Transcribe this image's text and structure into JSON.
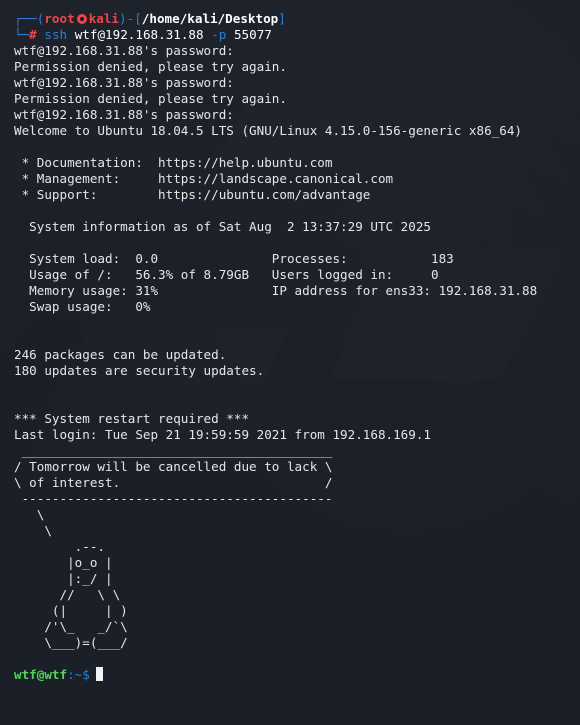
{
  "prompt1": {
    "user": "root",
    "host": "kali",
    "cwd": "/home/kali/Desktop",
    "cmd": "ssh",
    "args": "wtf@192.168.31.88",
    "flag": "-p",
    "port": "55077"
  },
  "lines": {
    "l1": "wtf@192.168.31.88's password:",
    "l2": "Permission denied, please try again.",
    "l3": "wtf@192.168.31.88's password:",
    "l4": "Permission denied, please try again.",
    "l5": "wtf@192.168.31.88's password:",
    "l6": "Welcome to Ubuntu 18.04.5 LTS (GNU/Linux 4.15.0-156-generic x86_64)",
    "l8": " * Documentation:  https://help.ubuntu.com",
    "l9": " * Management:     https://landscape.canonical.com",
    "l10": " * Support:        https://ubuntu.com/advantage",
    "l12": "  System information as of Sat Aug  2 13:37:29 UTC 2025",
    "l14": "  System load:  0.0               Processes:           183",
    "l15": "  Usage of /:   56.3% of 8.79GB   Users logged in:     0",
    "l16": "  Memory usage: 31%               IP address for ens33: 192.168.31.88",
    "l17": "  Swap usage:   0%",
    "l20": "246 packages can be updated.",
    "l21": "180 updates are security updates.",
    "l24": "*** System restart required ***",
    "l25": "Last login: Tue Sep 21 19:59:59 2021 from 192.168.169.1",
    "l26": " _________________________________________",
    "l27": "/ Tomorrow will be cancelled due to lack \\",
    "l28": "\\ of interest.                           /",
    "l29": " -----------------------------------------",
    "l30": "   \\",
    "l31": "    \\",
    "l32": "        .--.",
    "l33": "       |o_o |",
    "l34": "       |:_/ |",
    "l35": "      //   \\ \\",
    "l36": "     (|     | )",
    "l37": "    /'\\_   _/`\\",
    "l38": "    \\___)=(___/"
  },
  "prompt2": {
    "user": "wtf",
    "at": "@",
    "host": "wtf",
    "path": ":~$"
  },
  "colors": {
    "prompt_frame": "#2f7dd6",
    "root_user": "#f0454b",
    "user_host": "#4fd65a",
    "text": "#e6e6e6"
  }
}
